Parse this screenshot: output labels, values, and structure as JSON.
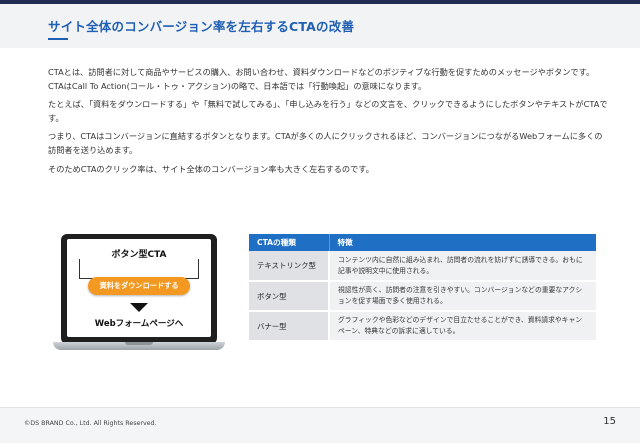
{
  "header": {
    "title": "サイト全体のコンバージョン率を左右するCTAの改善"
  },
  "body": {
    "paragraphs": [
      "CTAとは、訪問者に対して商品やサービスの購入、お問い合わせ、資料ダウンロードなどのポジティブな行動を促すためのメッセージやボタンです。CTAはCall To Action(コール・トゥ・アクション)の略で、日本語では「行動喚起」の意味になります。",
      "たとえば、「資料をダウンロードする」や「無料で試してみる」、「申し込みを行う」などの文言を、クリックできるようにしたボタンやテキストがCTAです。",
      "つまり、CTAはコンバージョンに直結するボタンとなります。CTAが多くの人にクリックされるほど、コンバージョンにつながるWebフォームに多くの訪問者を送り込めます。",
      "そのためCTAのクリック率は、サイト全体のコンバージョン率も大きく左右するのです。"
    ]
  },
  "illustration": {
    "heading": "ボタン型CTA",
    "button_label": "資料をダウンロードする",
    "destination": "Webフォームページへ"
  },
  "table": {
    "headers": [
      "CTAの種類",
      "特徴"
    ],
    "rows": [
      {
        "kind": "テキストリンク型",
        "desc": "コンテンツ内に自然に組み込まれ、訪問者の流れを妨げずに誘導できる。おもに記事や説明文中に使用される。"
      },
      {
        "kind": "ボタン型",
        "desc": "視認性が高く、訪問者の注意を引きやすい。コンバージョンなどの重要なアクションを促す場面で多く使用される。"
      },
      {
        "kind": "バナー型",
        "desc": "グラフィックや色彩などのデザインで目立たせることができ、資料請求やキャンペーン、特典などの訴求に適している。"
      }
    ]
  },
  "footer": {
    "copyright": "©DS BRAND Co., Ltd. All Rights Reserved.",
    "page_number": "15"
  },
  "colors": {
    "accent": "#1f5fb4",
    "table_header": "#1f6fc4",
    "cta_button": "#f39820"
  }
}
